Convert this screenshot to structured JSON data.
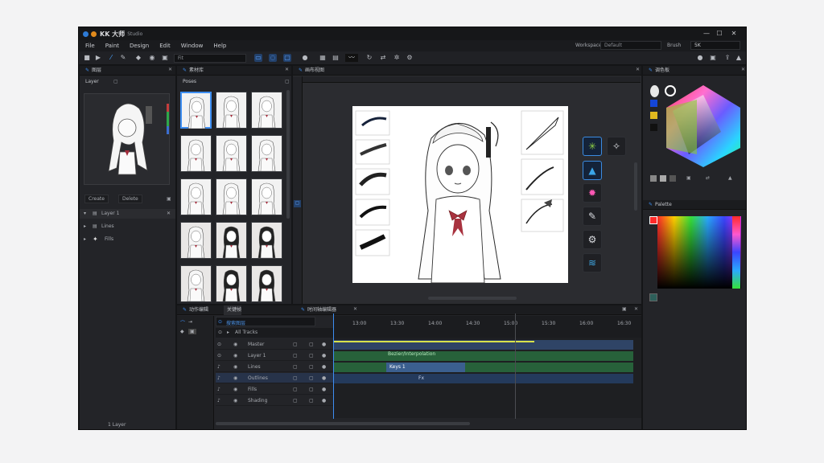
{
  "window": {
    "title": "KK 大师",
    "subtitle": "Studio",
    "controls": {
      "minimize": "—",
      "maximize": "☐",
      "close": "✕"
    }
  },
  "menu": {
    "items": [
      "File",
      "Paint",
      "Design",
      "Edit",
      "Window",
      "Help"
    ],
    "workspace_label": "Workspace",
    "workspace_value": "Default",
    "brush_label": "Brush",
    "brush_value": "5K"
  },
  "toolbar": {
    "zoom_value": "Fit"
  },
  "left_panel": {
    "tab_title": "图层",
    "subtab": "Layer",
    "buttons": [
      "Create",
      "Delete"
    ],
    "layers": [
      {
        "name": "Layer 1"
      },
      {
        "name": "Lines"
      },
      {
        "name": "Fills"
      }
    ],
    "footer": "1 Layer"
  },
  "library_panel": {
    "tab_title": "素材库",
    "subtab": "Poses"
  },
  "canvas_panel": {
    "tab_title": "画布视图"
  },
  "color_panel": {
    "tab_title": "调色板",
    "palette_title": "Palette"
  },
  "timeline": {
    "tabs": [
      "动作编辑",
      "关键帧",
      "时间轴编辑器"
    ],
    "search_value": "搜索图层",
    "header_label": "All Tracks",
    "time_marks": [
      "13:00",
      "13:30",
      "14:00",
      "14:30",
      "15:00",
      "15:30",
      "16:00",
      "16:30"
    ],
    "tracks": [
      "Master",
      "Layer 1",
      "Lines",
      "Outlines",
      "Fills",
      "Shading"
    ],
    "clip_labels": [
      "Bezier/Interpolation",
      "Keys 1",
      "Fx"
    ]
  },
  "colors": {
    "accent": "#3d8ef2",
    "track_blue": "#344f7c",
    "track_green": "#2a6a3b",
    "bg": "#1e1f22"
  }
}
